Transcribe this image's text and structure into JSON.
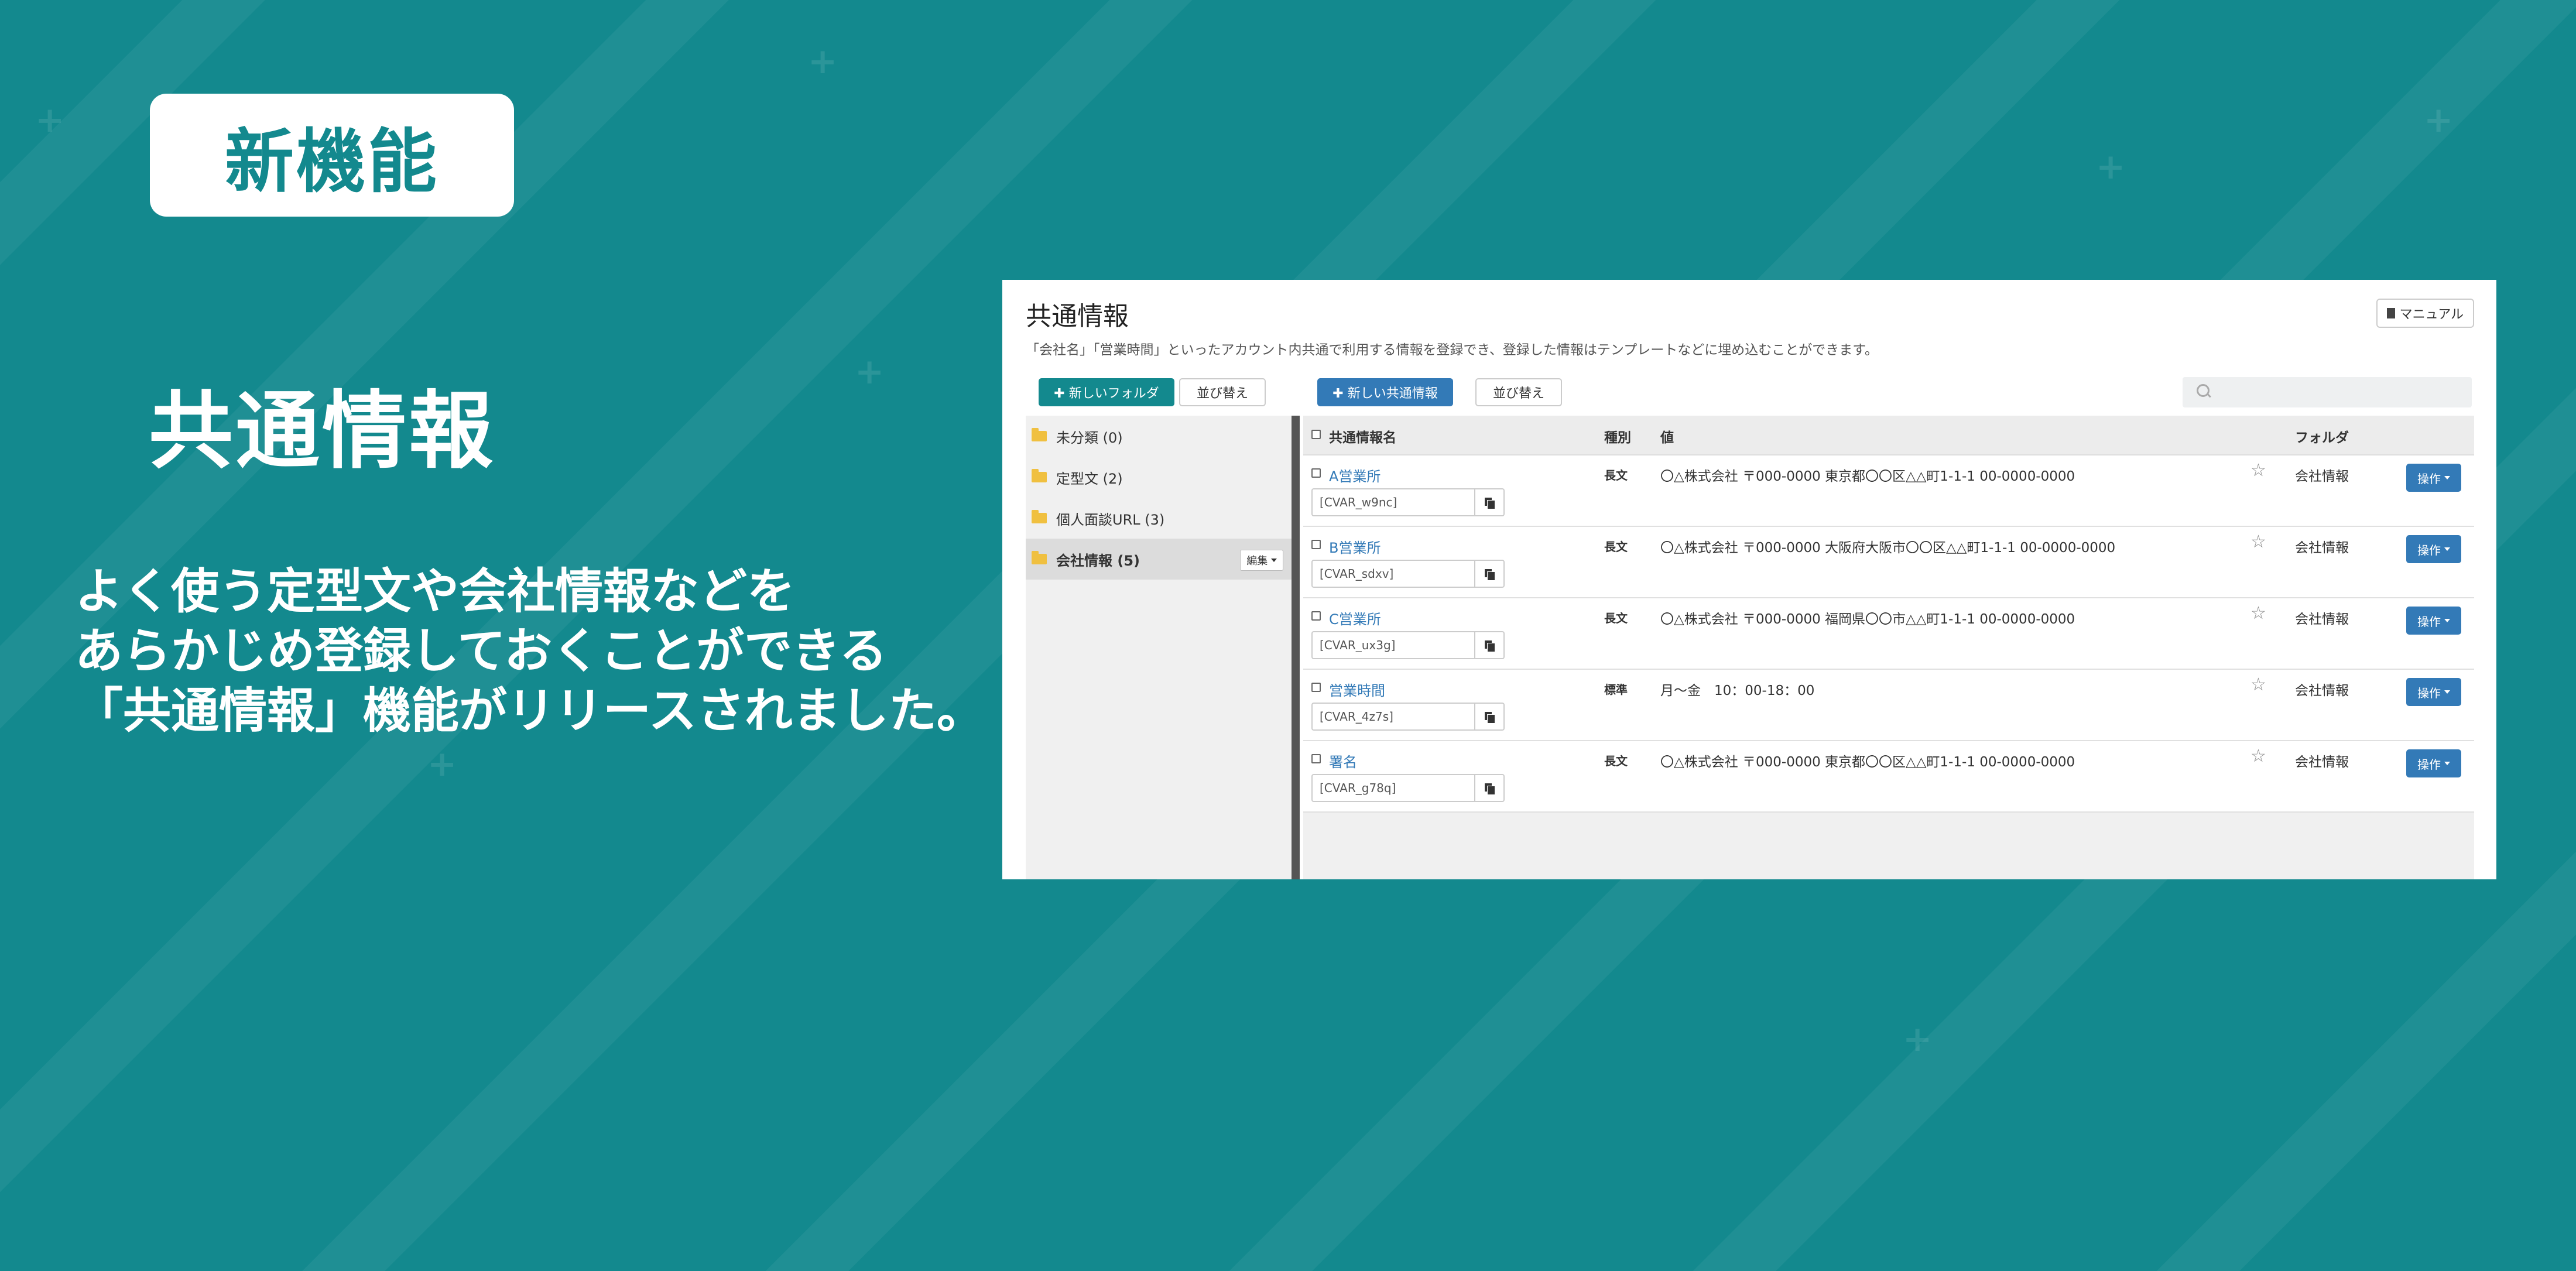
{
  "badge": "新機能",
  "feature_title": "共通情報",
  "description_lines": [
    "よく使う定型文や会社情報などを",
    "あらかじめ登録しておくことができる",
    "「共通情報」機能がリリースされました。"
  ],
  "screen": {
    "title": "共通情報",
    "manual_label": "マニュアル",
    "description": "「会社名」「営業時間」といったアカウント内共通で利用する情報を登録でき、登録した情報はテンプレートなどに埋め込むことができます。",
    "new_folder_label": "✚ 新しいフォルダ",
    "sort_label_1": "並び替え",
    "new_info_label": "✚ 新しい共通情報",
    "sort_label_2": "並び替え",
    "folders": [
      {
        "label": "未分類 (0)"
      },
      {
        "label": "定型文 (2)"
      },
      {
        "label": "個人面談URL (3)"
      },
      {
        "label": "会社情報 (5)"
      }
    ],
    "edit_label": "編集",
    "columns": {
      "name": "共通情報名",
      "kind": "種別",
      "value": "値",
      "folder": "フォルダ"
    },
    "operation_label": "操作",
    "rows": [
      {
        "name": "A営業所",
        "variable": "[CVAR_w9nc]",
        "kind": "長文",
        "value": "〇△株式会社 〒000-0000 東京都〇〇区△△町1-1-1 00-0000-0000",
        "folder": "会社情報"
      },
      {
        "name": "B営業所",
        "variable": "[CVAR_sdxv]",
        "kind": "長文",
        "value": "〇△株式会社 〒000-0000 大阪府大阪市〇〇区△△町1-1-1 00-0000-0000",
        "folder": "会社情報"
      },
      {
        "name": "C営業所",
        "variable": "[CVAR_ux3g]",
        "kind": "長文",
        "value": "〇△株式会社 〒000-0000 福岡県〇〇市△△町1-1-1 00-0000-0000",
        "folder": "会社情報"
      },
      {
        "name": "営業時間",
        "variable": "[CVAR_4z7s]",
        "kind": "標準",
        "value": "月～金　10：00-18：00",
        "folder": "会社情報"
      },
      {
        "name": "署名",
        "variable": "[CVAR_g78q]",
        "kind": "長文",
        "value": "〇△株式会社 〒000-0000 東京都〇〇区△△町1-1-1 00-0000-0000",
        "folder": "会社情報"
      }
    ]
  },
  "colors": {
    "background": "#13898e",
    "accent_blue": "#337ab7",
    "accent_teal": "#13898e"
  }
}
